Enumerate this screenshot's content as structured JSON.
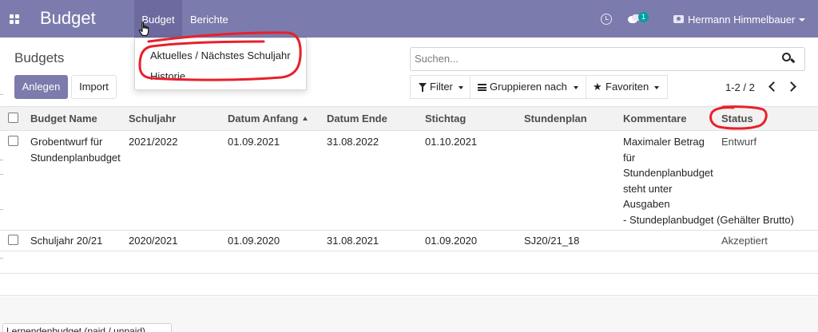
{
  "navbar": {
    "brand": "Budget",
    "menus": [
      {
        "label": "Budget"
      },
      {
        "label": "Berichte"
      }
    ],
    "chat_badge": "1",
    "user_name": "Hermann Himmelbauer",
    "icons": [
      "apps-icon",
      "clock-icon",
      "chat-icon",
      "camera-icon",
      "caret-down-icon"
    ]
  },
  "dropdown": {
    "items": [
      {
        "label": "Aktuelles / Nächstes Schuljahr"
      },
      {
        "label": "Historie"
      }
    ]
  },
  "control_panel": {
    "title": "Budgets",
    "create_label": "Anlegen",
    "import_label": "Import",
    "search_placeholder": "Suchen...",
    "filter_label": "Filter",
    "group_label": "Gruppieren nach",
    "favorites_label": "Favoriten",
    "pager": "1-2 / 2"
  },
  "table": {
    "columns": [
      {
        "label": "Budget Name"
      },
      {
        "label": "Schuljahr"
      },
      {
        "label": "Datum Anfang"
      },
      {
        "label": "Datum Ende"
      },
      {
        "label": "Stichtag"
      },
      {
        "label": "Stundenplan"
      },
      {
        "label": "Kommentare"
      },
      {
        "label": "Status"
      }
    ],
    "rows": [
      {
        "name_lines": [
          "Grobentwurf für",
          "Stundenplanbudget"
        ],
        "schuljahr": "2021/2022",
        "anfang": "01.09.2021",
        "ende": "31.08.2022",
        "stichtag": "01.10.2021",
        "stundenplan": "",
        "kommentar_lines": [
          "Maximaler Betrag",
          "für",
          "Stundenplanbudget",
          "steht unter",
          "Ausgaben",
          "- Stundeplanbudget (Gehälter Brutto)"
        ],
        "status": "Entwurf"
      },
      {
        "name_lines": [
          "Schuljahr 20/21"
        ],
        "schuljahr": "2020/2021",
        "anfang": "01.09.2020",
        "ende": "31.08.2021",
        "stichtag": "01.09.2020",
        "stundenplan": "SJ20/21_18",
        "kommentar_lines": [
          ""
        ],
        "status": "Akzeptiert"
      }
    ]
  },
  "bottom": {
    "bubble_text": "Lernendenbudget (paid / unpaid)"
  },
  "colors": {
    "brand": "#7c7bad",
    "menu_active": "#6c6a9e",
    "annotation": "#e8202a",
    "badge": "#00a09d"
  }
}
